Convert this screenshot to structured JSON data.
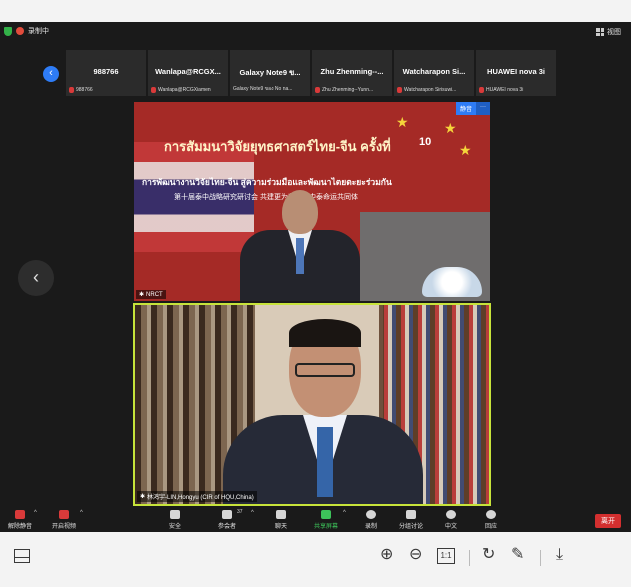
{
  "topbar": {
    "recording_label": "录制中",
    "view_label": "视图"
  },
  "thumbnails": [
    {
      "name": "988766",
      "sub": "988766"
    },
    {
      "name": "Wanlapa@RCGX...",
      "sub": "Wanlapa@RCGXiamen"
    },
    {
      "name": "Galaxy Note9 ข...",
      "sub": "Galaxy Note9 ของ No na..."
    },
    {
      "name": "Zhu Zhenming--...",
      "sub": "Zhu Zhenming--Yunn..."
    },
    {
      "name": "Watcharapon Si...",
      "sub": "Watcharapon Sirisuwi..."
    },
    {
      "name": "HUAWEI nova 3i",
      "sub": "HUAWEI nova 3i"
    }
  ],
  "video1": {
    "banner": "การสัมมนาวิจัยยุทธศาสตร์ไทย-จีน ครั้งที่",
    "number": "10",
    "line2": "การพัฒนางานวิจัยไทย-จีน สู่ความร่วมมือและพัฒนาไตยตะยะร่วมกัน",
    "line3": "第十届泰中战略研究研讨会 共建更为紧密的中泰命运共同体",
    "label": "NRCT",
    "tag1": "静音",
    "tag2": "···"
  },
  "video2": {
    "label": "林鸿宇-LIN,Hongyu (CIR of HQU,China)"
  },
  "toolbar": {
    "unmute": "解除静音",
    "start_video": "开启视频",
    "security": "安全",
    "participants": "参会者",
    "participants_count": "37",
    "chat": "聊天",
    "share": "共享屏幕",
    "record": "录制",
    "breakout": "分组讨论",
    "interpret": "中文",
    "reactions": "回应",
    "leave": "离开"
  },
  "viewer": {
    "one_to_one": "1:1"
  }
}
